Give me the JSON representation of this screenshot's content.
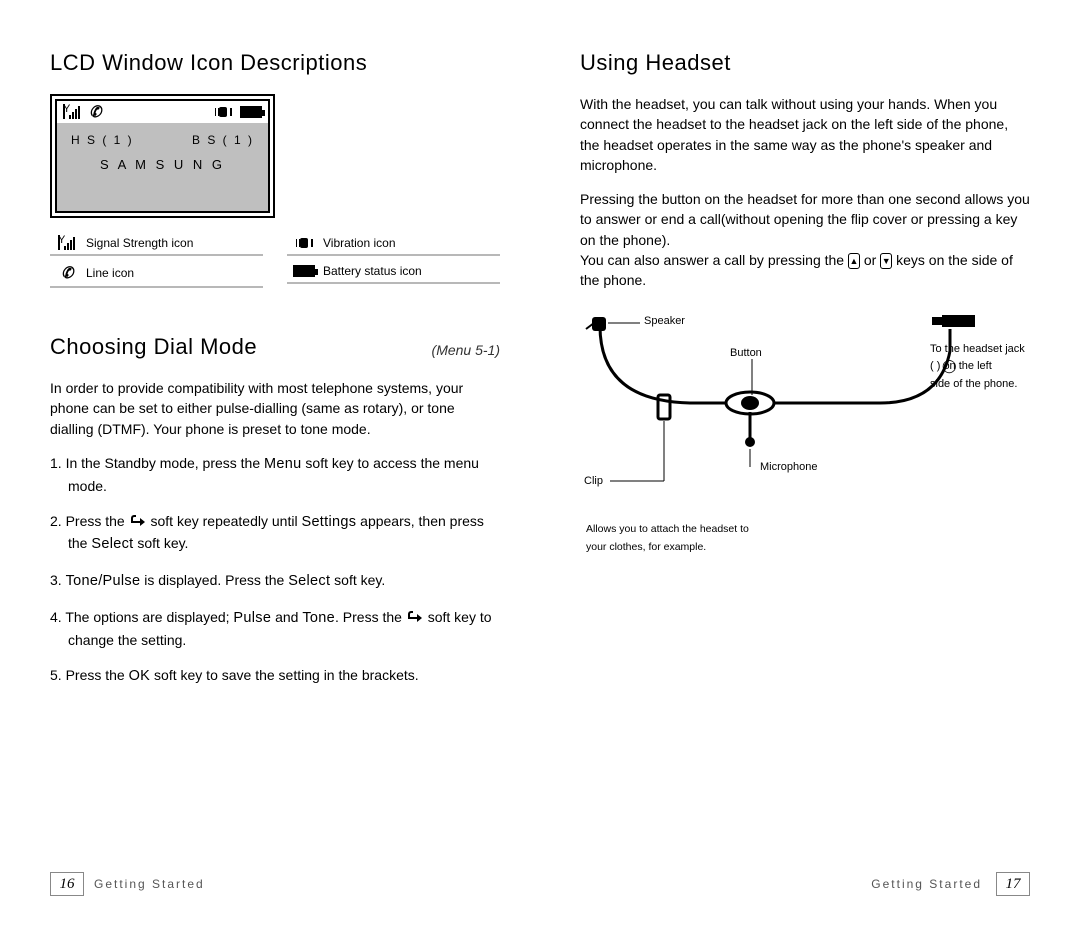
{
  "left": {
    "title1": "LCD Window Icon Descriptions",
    "lcd": {
      "hs": "H S ( 1 )",
      "bs": "B S ( 1 )",
      "brand": "S A M S U N G"
    },
    "legend": {
      "signal": "Signal Strength icon",
      "line": "Line icon",
      "vibration": "Vibration icon",
      "battery": "Battery status icon"
    },
    "title2": "Choosing Dial Mode",
    "menu_ref": "(Menu 5-1)",
    "intro": "In order to provide compatibility with most telephone systems, your phone can be set to either pulse-dialling (same as rotary), or tone dialling (DTMF). Your phone is preset to tone mode.",
    "step1a": "1. In the Standby mode, press the ",
    "step1_menu": "Menu",
    "step1b": " soft key to access the  menu mode.",
    "step2a": "2. Press the  ",
    "step2b": "  soft key repeatedly until ",
    "step2_settings": "Settings",
    "step2c": " appears, then press the ",
    "step2_select": "Select",
    "step2d": " soft key.",
    "step3a": "3. ",
    "step3_tp": "Tone/Pulse",
    "step3b": " is displayed. Press the ",
    "step3_select": "Select",
    "step3c": " soft key.",
    "step4a": "4. The options are displayed; ",
    "step4_pulse": "Pulse",
    "step4_and": " and ",
    "step4_tone": "Tone",
    "step4b": ". Press the  ",
    "step4c": " soft key to change the setting.",
    "step5a": "5. Press the ",
    "step5_ok": "OK",
    "step5b": " soft key to save the setting in the brackets."
  },
  "right": {
    "title": "Using Headset",
    "p1": "With the headset, you can talk without using your hands. When you connect the headset to the headset jack on the left side of the phone, the headset operates in the same way as the phone's speaker and microphone.",
    "p2a": "Pressing the button on the headset for more than one second allows you to answer or end a call(without opening the flip cover or  pressing a key on the phone).",
    "p2b_a": "You can also answer a call by pressing the ",
    "p2b_or": " or ",
    "p2b_b": " keys on the side of the phone.",
    "diagram": {
      "speaker": "Speaker",
      "button": "Button",
      "microphone": "Microphone",
      "clip": "Clip",
      "jack1": "To the headset jack",
      "jack2": "(        ) on the left",
      "jack3": "side of the phone.",
      "clip_cap1": "Allows  you  to attach the  headset  to",
      "clip_cap2": "your clothes, for example."
    }
  },
  "footer": {
    "section": "Getting Started",
    "page_left": "16",
    "page_right": "17"
  }
}
